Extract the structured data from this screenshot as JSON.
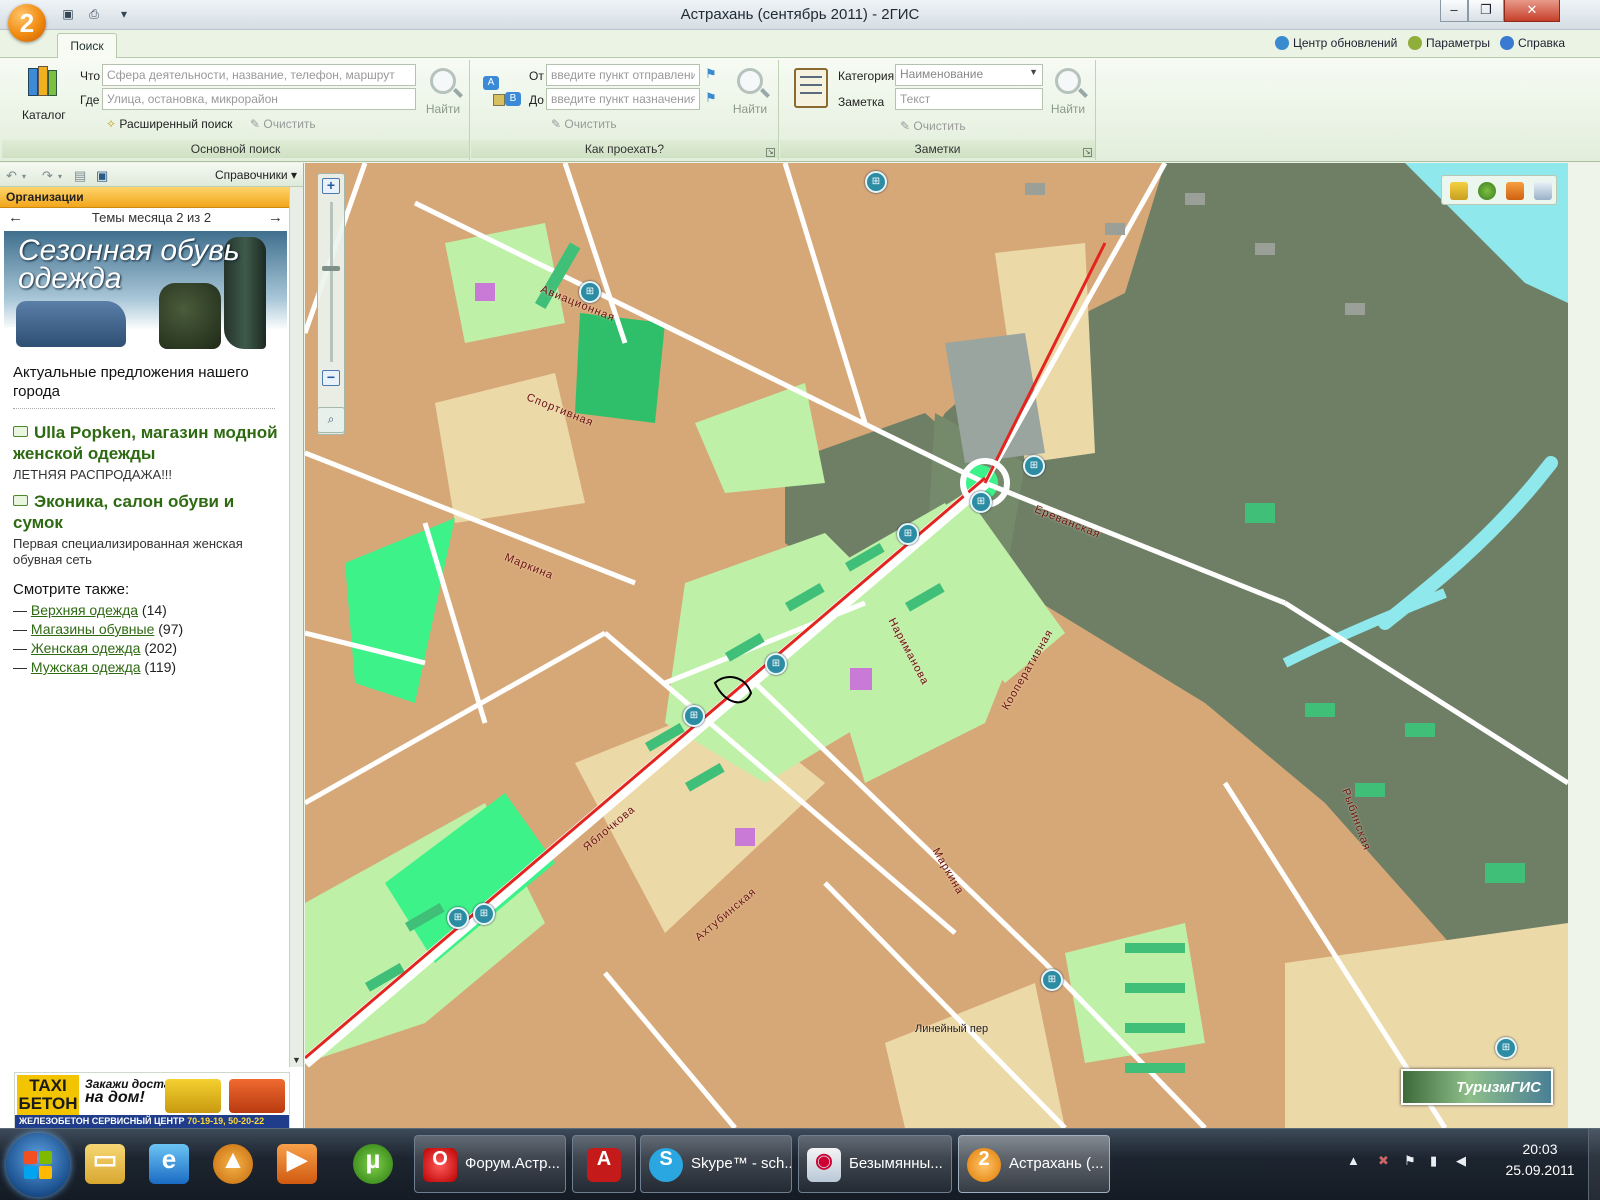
{
  "window": {
    "title": "Астрахань (сентябрь 2011) - 2ГИС",
    "logo": "2",
    "minimize": "–",
    "maximize": "❐",
    "close": "✕"
  },
  "ribbon": {
    "tab": "Поиск",
    "top_links": [
      "Центр обновлений",
      "Параметры",
      "Справка"
    ],
    "main_search": {
      "catalog_label": "Каталог",
      "what_label": "Что",
      "what_placeholder": "Сфера деятельности, название, телефон, маршрут",
      "where_label": "Где",
      "where_placeholder": "Улица, остановка, микрорайон",
      "advanced": "Расширенный поиск",
      "clear": "Очистить",
      "find": "Найти",
      "group_label": "Основной поиск"
    },
    "route": {
      "from_label": "От",
      "from_placeholder": "введите пункт отправления",
      "to_label": "До",
      "to_placeholder": "введите пункт назначения",
      "clear": "Очистить",
      "find": "Найти",
      "group_label": "Как проехать?"
    },
    "notes": {
      "category_label": "Категория",
      "category_value": "Наименование",
      "note_label": "Заметка",
      "note_placeholder": "Текст",
      "clear": "Очистить",
      "find": "Найти",
      "group_label": "Заметки"
    }
  },
  "left_panel": {
    "handbook": "Справочники",
    "section": "Организации",
    "themes_nav": "Темы месяца 2 из 2",
    "banner_text": "Сезонная обувь одежда",
    "intro": "Актуальные предложения нашего города",
    "orgs": [
      {
        "name": "Ulla Popken, магазин модной женской одежды",
        "desc": "ЛЕТНЯЯ РАСПРОДАЖА!!!"
      },
      {
        "name": "Эконика, салон обуви и сумок",
        "desc": "Первая специализированная женская обувная сеть"
      }
    ],
    "see_also": "Смотрите также:",
    "categories": [
      {
        "name": "Верхняя одежда",
        "count": "(14)"
      },
      {
        "name": "Магазины обувные",
        "count": "(97)"
      },
      {
        "name": "Женская одежда",
        "count": "(202)"
      },
      {
        "name": "Мужская одежда",
        "count": "(119)"
      }
    ],
    "ad": {
      "logo": "TAXI БЕТОН",
      "slogan_1": "Закажи доставку",
      "slogan_2": "на дом!",
      "company": "ЖЕЛЕЗОБЕТОН СЕРВИСНЫЙ ЦЕНТР",
      "phones": "70-19-19, 50-20-22"
    }
  },
  "map": {
    "streets": [
      "Авиационная",
      "Спортивная",
      "Маркина",
      "Ереванская",
      "Нариманова",
      "Кооперативная",
      "Яблочкова",
      "Ахтубинская",
      "Маркина",
      "Рыбинская",
      "Линейный пер"
    ],
    "badge": "ТуризмГИС"
  },
  "taskbar": {
    "tasks": [
      "Форум.Астр...",
      "Skype™ - sch...",
      "Безымянны...",
      "Астрахань (..."
    ],
    "time": "20:03",
    "date": "25.09.2011"
  },
  "colors": {
    "block_tan": "#d7a877",
    "block_light": "#ecd9a8",
    "park_light": "#bff0a8",
    "park_bright": "#3ef28a",
    "industrial": "#6e7f65",
    "water": "#8ee8ec",
    "road": "#ffffff",
    "main_road": "#e3241f",
    "accent_orange": "#f2a61c",
    "link_green": "#2e6a12"
  }
}
